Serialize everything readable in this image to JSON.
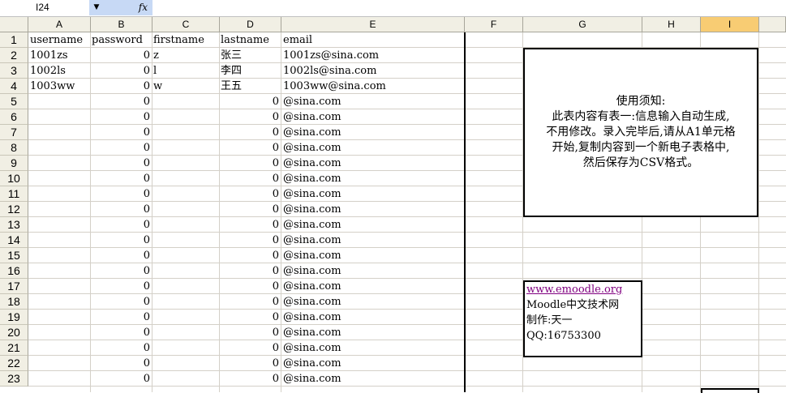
{
  "namebox": {
    "ref": "I24",
    "dropdown_icon": "dropdown-arrow",
    "fx_label": "fx"
  },
  "columns": [
    "A",
    "B",
    "C",
    "D",
    "E",
    "F",
    "G",
    "H",
    "I"
  ],
  "selected_column": "I",
  "rows": [
    "1",
    "2",
    "3",
    "4",
    "5",
    "6",
    "7",
    "8",
    "9",
    "10",
    "11",
    "12",
    "13",
    "14",
    "15",
    "16",
    "17",
    "18",
    "19",
    "20",
    "21",
    "22",
    "23"
  ],
  "table": {
    "headers": [
      "username",
      "password",
      "firstname",
      "lastname",
      "email"
    ],
    "data": [
      [
        "1001zs",
        "0",
        "z",
        "张三",
        "1001zs@sina.com"
      ],
      [
        "1002ls",
        "0",
        "l",
        "李四",
        "1002ls@sina.com"
      ],
      [
        "1003ww",
        "0",
        "w",
        "王五",
        "1003ww@sina.com"
      ],
      [
        "",
        "0",
        "",
        "0",
        "@sina.com"
      ],
      [
        "",
        "0",
        "",
        "0",
        "@sina.com"
      ],
      [
        "",
        "0",
        "",
        "0",
        "@sina.com"
      ],
      [
        "",
        "0",
        "",
        "0",
        "@sina.com"
      ],
      [
        "",
        "0",
        "",
        "0",
        "@sina.com"
      ],
      [
        "",
        "0",
        "",
        "0",
        "@sina.com"
      ],
      [
        "",
        "0",
        "",
        "0",
        "@sina.com"
      ],
      [
        "",
        "0",
        "",
        "0",
        "@sina.com"
      ],
      [
        "",
        "0",
        "",
        "0",
        "@sina.com"
      ],
      [
        "",
        "0",
        "",
        "0",
        "@sina.com"
      ],
      [
        "",
        "0",
        "",
        "0",
        "@sina.com"
      ],
      [
        "",
        "0",
        "",
        "0",
        "@sina.com"
      ],
      [
        "",
        "0",
        "",
        "0",
        "@sina.com"
      ],
      [
        "",
        "0",
        "",
        "0",
        "@sina.com"
      ],
      [
        "",
        "0",
        "",
        "0",
        "@sina.com"
      ],
      [
        "",
        "0",
        "",
        "0",
        "@sina.com"
      ],
      [
        "",
        "0",
        "",
        "0",
        "@sina.com"
      ],
      [
        "",
        "0",
        "",
        "0",
        "@sina.com"
      ],
      [
        "",
        "0",
        "",
        "0",
        "@sina.com"
      ]
    ]
  },
  "notice": {
    "text": "使用须知:\n此表内容有表一:信息输入自动生成,\n不用修改。录入完毕后,请从A1单元格\n开始,复制内容到一个新电子表格中,\n然后保存为CSV格式。"
  },
  "credits": {
    "link": "www.emoodle.org",
    "line2": "Moodle中文技术网",
    "line3": "制作:天一",
    "line4": "QQ:16753300"
  },
  "colors": {
    "header_bg": "#f1efe4",
    "selected_header": "#f8cc73",
    "link": "#800080",
    "namebox_accent": "#c7d9f5"
  }
}
